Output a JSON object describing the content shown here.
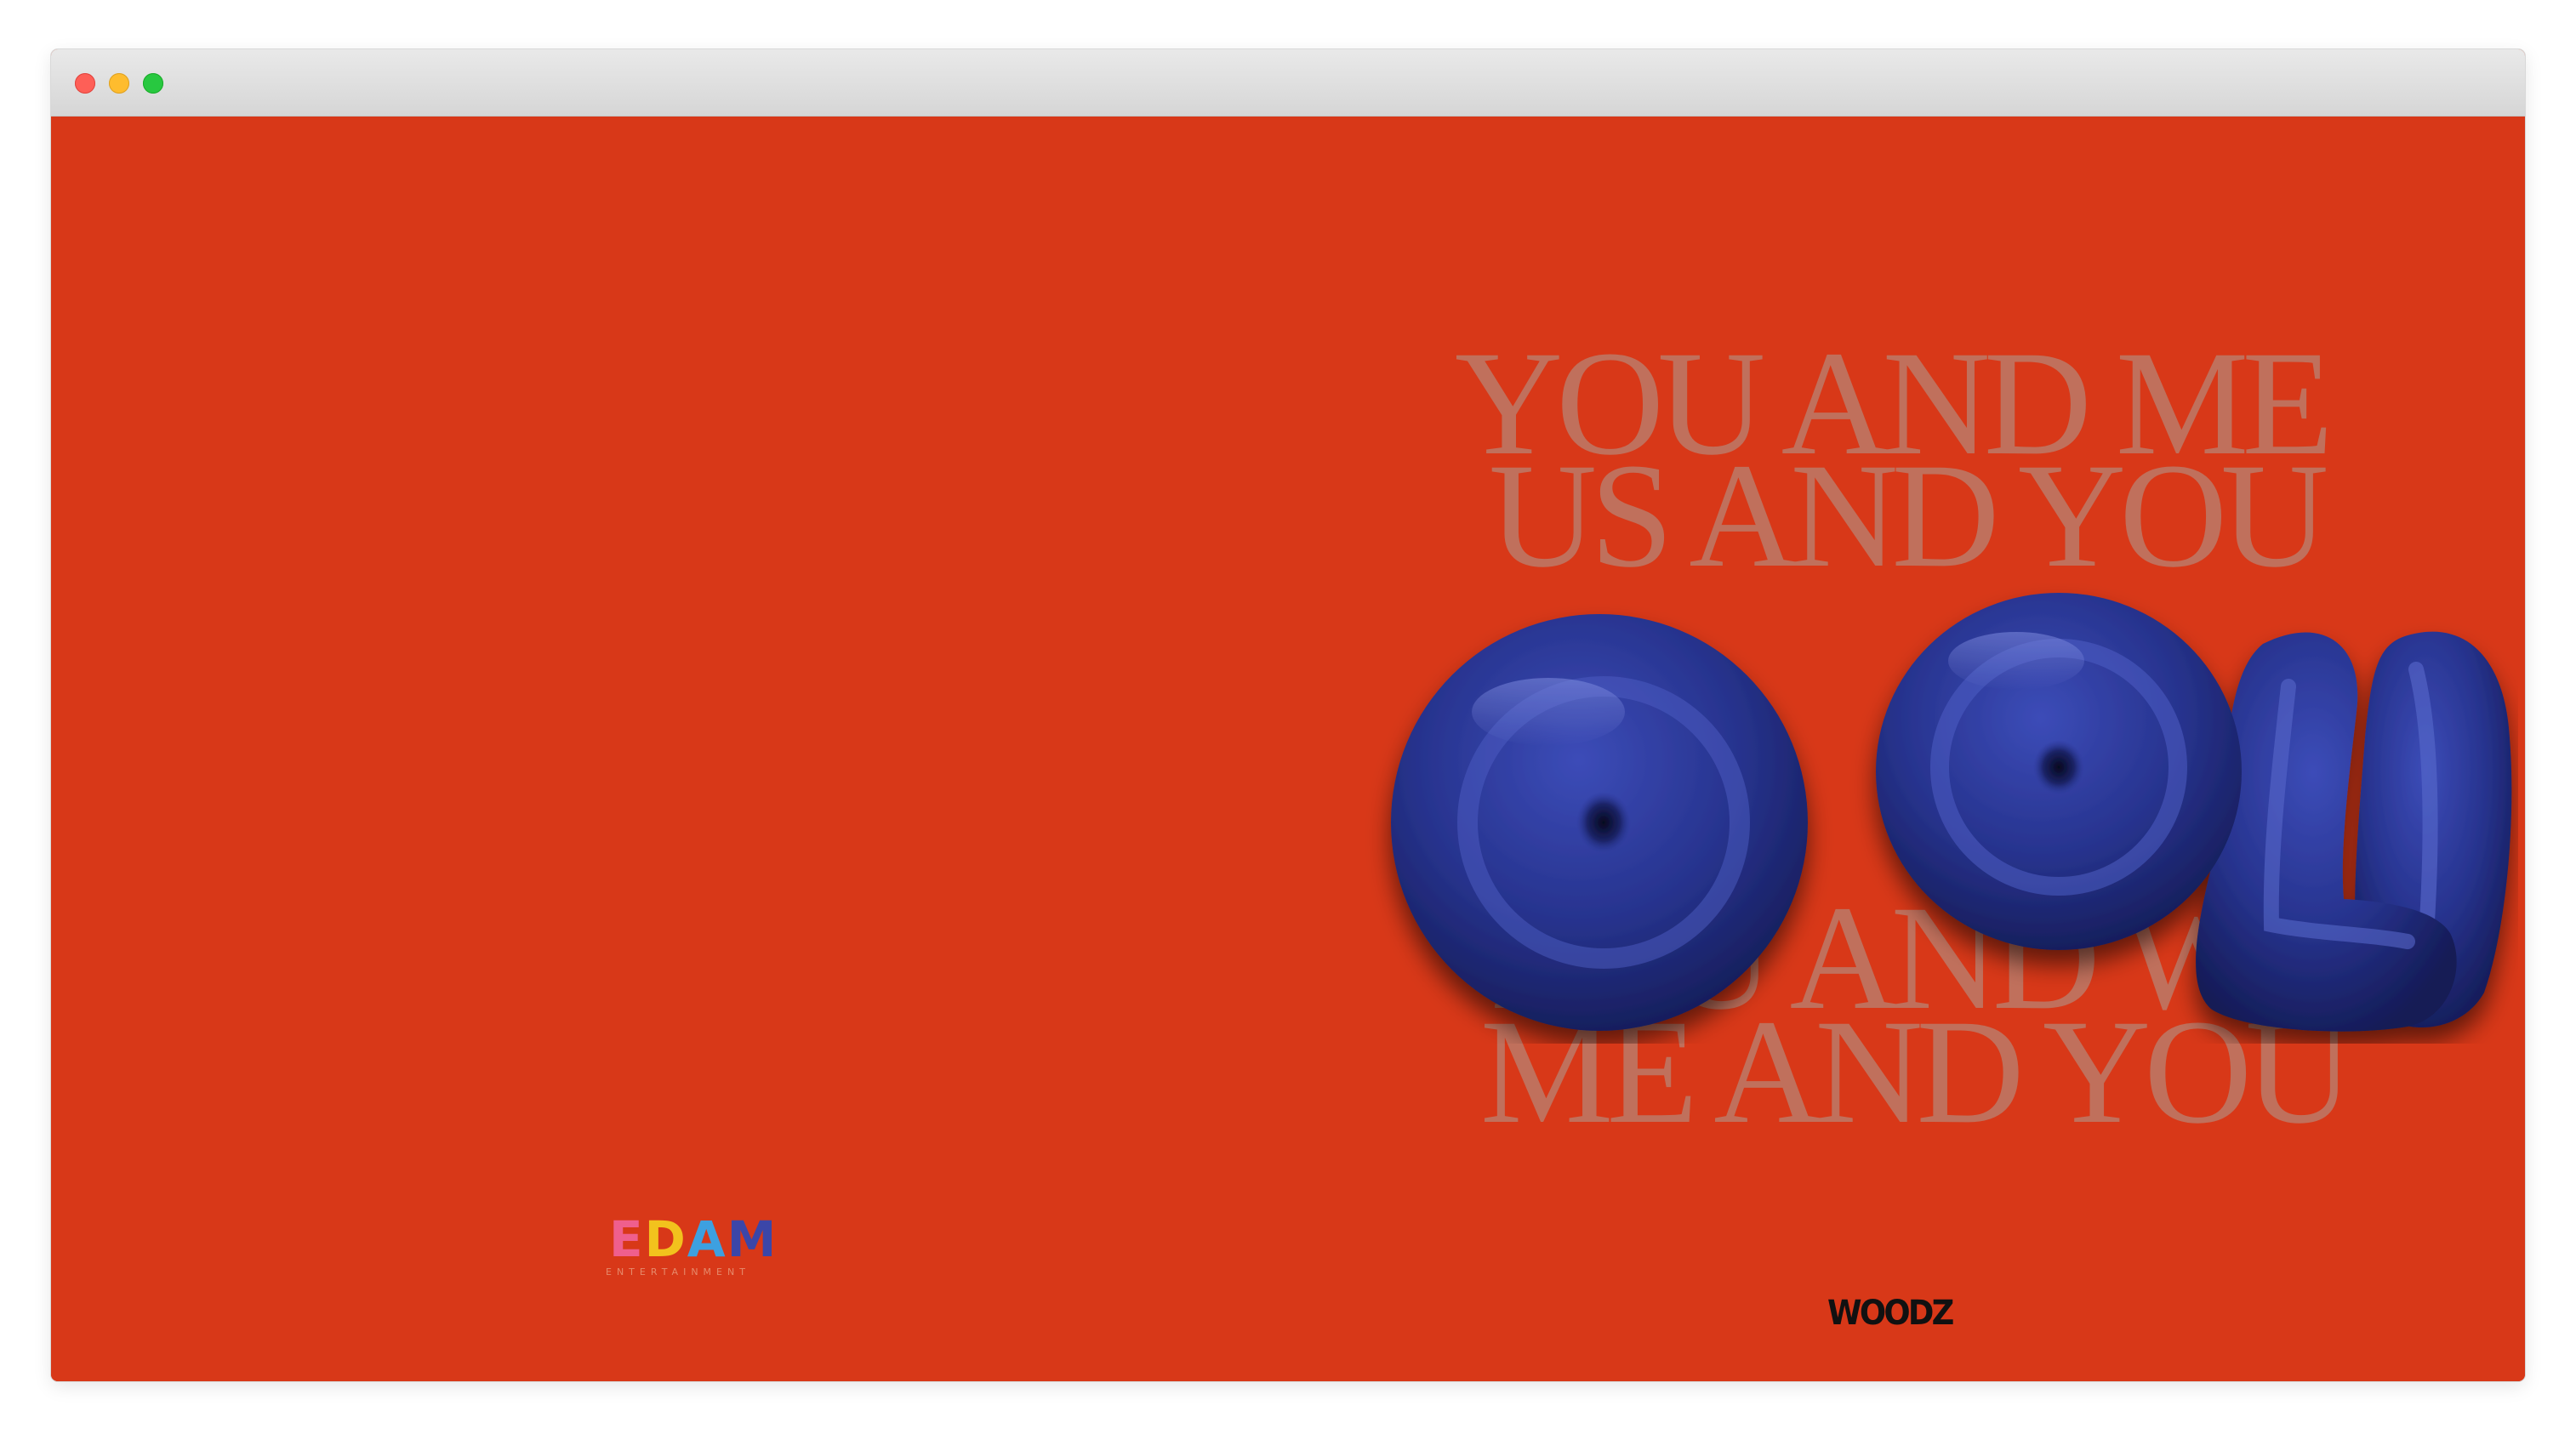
{
  "window": {
    "controls": [
      "close",
      "minimize",
      "zoom"
    ]
  },
  "colors": {
    "background": "#d83818",
    "lyrics_text": "#c0705c",
    "bubble_blue": "#2a3694",
    "woodz_text": "#111111",
    "edam_e": "#ef5f8d",
    "edam_d": "#f2c21d",
    "edam_a": "#3da0e0",
    "edam_m": "#3b46a8"
  },
  "lyrics": {
    "line1": "YOU AND ME",
    "line2": "US AND YOU",
    "line3": "YOU AND WE",
    "line4": "ME AND YOU"
  },
  "artwork": {
    "title": "OOLI",
    "icon": "inflated-bubble-letters"
  },
  "edam_logo": {
    "letters": [
      "E",
      "D",
      "A",
      "M"
    ],
    "subtitle": "ENTERTAINMENT"
  },
  "artist": {
    "name": "WOODZ"
  }
}
